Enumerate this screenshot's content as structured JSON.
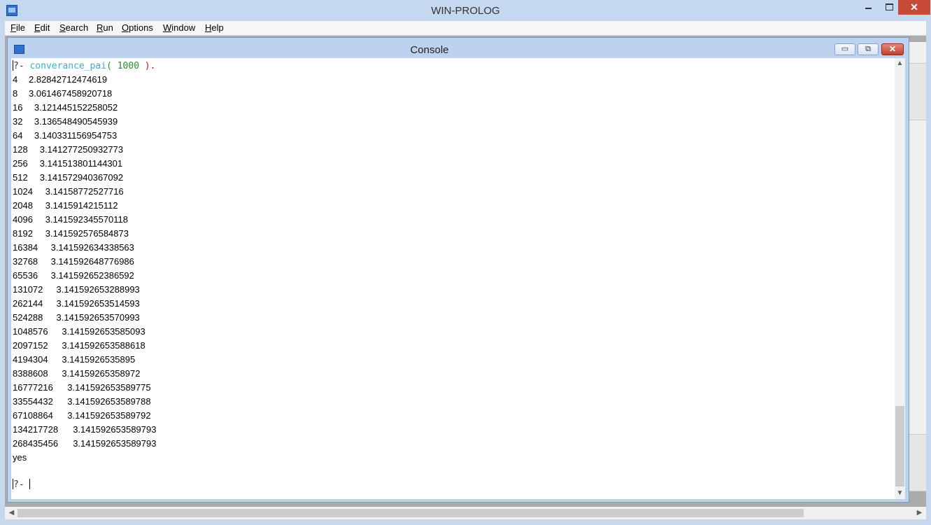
{
  "app": {
    "title": "WIN-PROLOG",
    "close_glyph": "✕"
  },
  "menu": [
    {
      "underline": "F",
      "rest": "ile"
    },
    {
      "underline": "E",
      "rest": "dit"
    },
    {
      "underline": "S",
      "rest": "earch"
    },
    {
      "underline": "R",
      "rest": "un"
    },
    {
      "underline": "O",
      "rest": "ptions"
    },
    {
      "underline": "W",
      "rest": "indow"
    },
    {
      "underline": "H",
      "rest": "elp"
    }
  ],
  "console": {
    "title": "Console",
    "min_glyph": "▭",
    "restore_glyph": "⧉",
    "close_glyph": "✕",
    "query": {
      "prompt": "?-",
      "command": "converance_pai",
      "open_paren": "(",
      "argument": "1000",
      "close": ").",
      "spacer": " "
    },
    "output_rows": [
      {
        "n": "4",
        "value": "2.82842712474619"
      },
      {
        "n": "8",
        "value": "3.061467458920718"
      },
      {
        "n": "16",
        "value": "3.121445152258052"
      },
      {
        "n": "32",
        "value": "3.136548490545939"
      },
      {
        "n": "64",
        "value": "3.140331156954753"
      },
      {
        "n": "128",
        "value": "3.141277250932773"
      },
      {
        "n": "256",
        "value": "3.141513801144301"
      },
      {
        "n": "512",
        "value": "3.141572940367092"
      },
      {
        "n": "1024",
        "value": "3.14158772527716"
      },
      {
        "n": "2048",
        "value": "3.1415914215112"
      },
      {
        "n": "4096",
        "value": "3.141592345570118"
      },
      {
        "n": "8192",
        "value": "3.141592576584873"
      },
      {
        "n": "16384",
        "value": "3.141592634338563"
      },
      {
        "n": "32768",
        "value": "3.141592648776986"
      },
      {
        "n": "65536",
        "value": "3.141592652386592"
      },
      {
        "n": "131072",
        "value": "3.141592653288993"
      },
      {
        "n": "262144",
        "value": "3.141592653514593"
      },
      {
        "n": "524288",
        "value": "3.141592653570993"
      },
      {
        "n": "1048576",
        "value": "3.141592653585093"
      },
      {
        "n": "2097152",
        "value": "3.141592653588618"
      },
      {
        "n": "4194304",
        "value": "3.1415926535895"
      },
      {
        "n": "8388608",
        "value": "3.14159265358972"
      },
      {
        "n": "16777216",
        "value": "3.141592653589775"
      },
      {
        "n": "33554432",
        "value": "3.141592653589788"
      },
      {
        "n": "67108864",
        "value": "3.141592653589792"
      },
      {
        "n": "134217728",
        "value": "3.141592653589793"
      },
      {
        "n": "268435456",
        "value": "3.141592653589793"
      }
    ],
    "result": "yes",
    "next_prompt": "?-"
  },
  "scrollbars": {
    "up_glyph": "▲",
    "down_glyph": "▼",
    "left_glyph": "◀",
    "right_glyph": "▶"
  }
}
